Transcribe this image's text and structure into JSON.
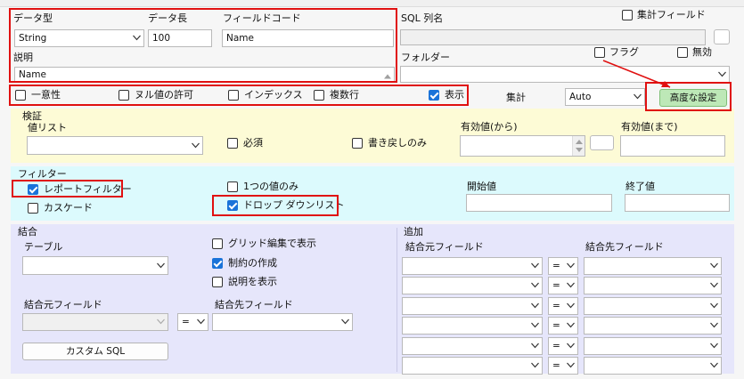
{
  "general": {
    "data_type_label": "データ型",
    "data_type_value": "String",
    "data_length_label": "データ長",
    "data_length_value": "100",
    "field_code_label": "フィールドコード",
    "field_code_value": "Name",
    "description_label": "説明",
    "description_value": "Name",
    "sql_column_label": "SQL 列名",
    "aggregate_field_label": "集計フィールド",
    "folder_label": "フォルダー",
    "flag_label": "フラグ",
    "disabled_label": "無効"
  },
  "options": {
    "unique_label": "一意性",
    "allow_null_label": "ヌル値の許可",
    "index_label": "インデックス",
    "multiline_label": "複数行",
    "display_label": "表示",
    "aggregate_label": "集計",
    "aggregate_value": "Auto",
    "advanced_button": "高度な設定"
  },
  "validation": {
    "title": "検証",
    "value_list_label": "値リスト",
    "required_label": "必須",
    "writeback_label": "書き戻しのみ",
    "valid_from_label": "有効値(から)",
    "valid_to_label": "有効値(まで)"
  },
  "filter": {
    "title": "フィルター",
    "report_filter_label": "レポートフィルター",
    "cascade_label": "カスケード",
    "single_value_label": "1つの値のみ",
    "dropdown_list_label": "ドロップ ダウンリスト",
    "start_value_label": "開始値",
    "end_value_label": "終了値"
  },
  "join": {
    "title": "結合",
    "table_label": "テーブル",
    "grid_edit_label": "グリッド編集で表示",
    "create_constraint_label": "制約の作成",
    "show_description_label": "説明を表示",
    "source_field_label": "結合元フィールド",
    "target_field_label": "結合先フィールド",
    "operator_value": "=",
    "custom_sql_button": "カスタム SQL"
  },
  "additional": {
    "title": "追加",
    "source_field_label": "結合元フィールド",
    "target_field_label": "結合先フィールド",
    "operator_value": "="
  },
  "colors": {
    "validation_bg": "#fdfbd6",
    "filter_bg": "#dcfafd",
    "join_bg": "#e6e6fb",
    "annotation_red": "#e01010",
    "advanced_btn_bg": "#bde8b7",
    "check_blue": "#1a73d9"
  }
}
